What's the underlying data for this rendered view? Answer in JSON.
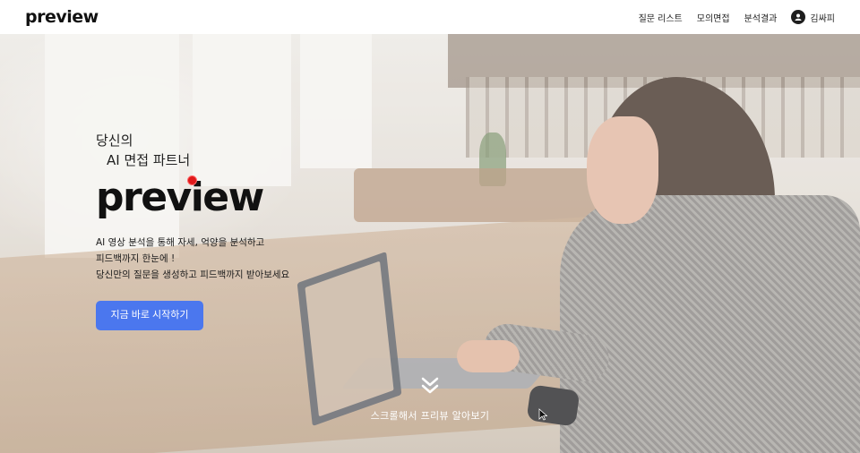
{
  "header": {
    "logo": "preview",
    "nav": [
      {
        "label": "질문 리스트"
      },
      {
        "label": "모의면접"
      },
      {
        "label": "분석결과"
      }
    ],
    "user_name": "김싸피"
  },
  "hero": {
    "subtitle_line1": "당신의",
    "subtitle_line2": "AI 면접 파트너",
    "logo": "preview",
    "description": [
      "AI 영상 분석을 통해 자세, 억양을 분석하고",
      "피드백까지 한눈에 !",
      "당신만의 질문을 생성하고 피드백까지 받아보세요"
    ],
    "cta_label": "지금 바로 시작하기",
    "scroll_hint": "스크롤해서 프리뷰 알아보기"
  },
  "colors": {
    "accent": "#4b77ee",
    "record_dot": "#e0191b"
  },
  "icons": [
    "avatar-icon",
    "scroll-down-chevron-icon",
    "mouse-cursor-icon"
  ]
}
